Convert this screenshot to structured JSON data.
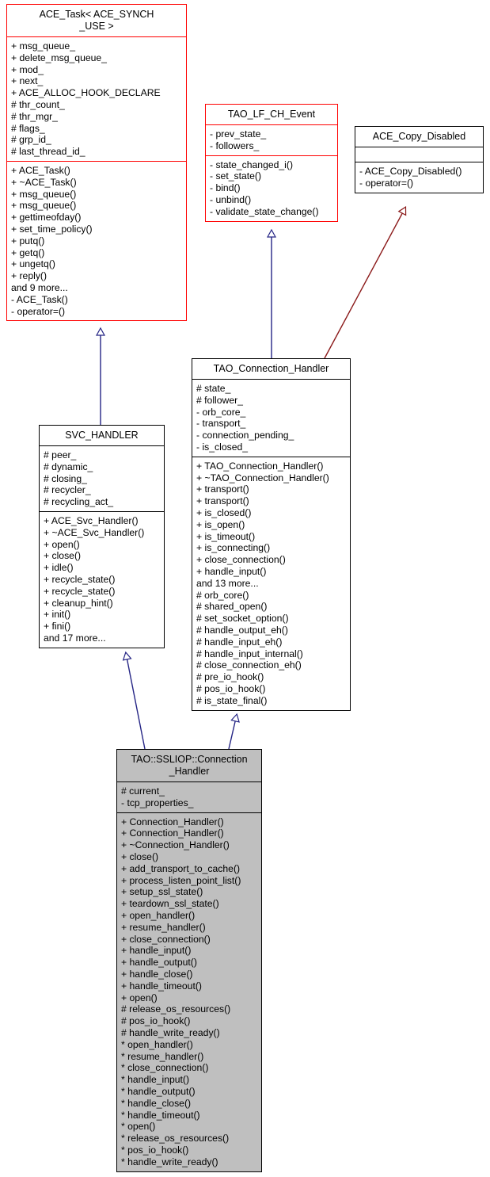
{
  "diagram": {
    "title": "TAO::SSLIOP::Connection_Handler inheritance diagram",
    "type": "uml-class-diagram",
    "background": "#ffffff",
    "colors": {
      "highlight_border": "#ff0000",
      "normal_border": "#000000",
      "derived_fill": "#bfbfbf",
      "inheritance_edge": "#252585",
      "usage_edge": "#8b1a1a"
    }
  },
  "classes": {
    "ace_task": {
      "name": "ACE_Task< ACE_SYNCH\n_USE >",
      "attributes": [
        "+ msg_queue_",
        "+ delete_msg_queue_",
        "+ mod_",
        "+ next_",
        "+ ACE_ALLOC_HOOK_DECLARE",
        "# thr_count_",
        "# thr_mgr_",
        "# flags_",
        "# grp_id_",
        "# last_thread_id_"
      ],
      "operations": [
        "+ ACE_Task()",
        "+ ~ACE_Task()",
        "+ msg_queue()",
        "+ msg_queue()",
        "+ gettimeofday()",
        "+ set_time_policy()",
        "+ putq()",
        "+ getq()",
        "+ ungetq()",
        "+ reply()",
        "and 9 more...",
        "- ACE_Task()",
        "- operator=()"
      ]
    },
    "tao_lf_ch_event": {
      "name": "TAO_LF_CH_Event",
      "attributes": [
        "- prev_state_",
        "- followers_"
      ],
      "operations": [
        "- state_changed_i()",
        "- set_state()",
        "- bind()",
        "- unbind()",
        "- validate_state_change()"
      ]
    },
    "ace_copy_disabled": {
      "name": "ACE_Copy_Disabled",
      "attributes": [],
      "operations": [
        "- ACE_Copy_Disabled()",
        "- operator=()"
      ]
    },
    "tao_connection_handler": {
      "name": "TAO_Connection_Handler",
      "attributes": [
        "# state_",
        "# follower_",
        "- orb_core_",
        "- transport_",
        "- connection_pending_",
        "- is_closed_"
      ],
      "operations": [
        "+ TAO_Connection_Handler()",
        "+ ~TAO_Connection_Handler()",
        "+ transport()",
        "+ transport()",
        "+ is_closed()",
        "+ is_open()",
        "+ is_timeout()",
        "+ is_connecting()",
        "+ close_connection()",
        "+ handle_input()",
        "and 13 more...",
        "# orb_core()",
        "# shared_open()",
        "# set_socket_option()",
        "# handle_output_eh()",
        "# handle_input_eh()",
        "# handle_input_internal()",
        "# close_connection_eh()",
        "# pre_io_hook()",
        "# pos_io_hook()",
        "# is_state_final()"
      ]
    },
    "svc_handler": {
      "name": "SVC_HANDLER",
      "attributes": [
        "# peer_",
        "# dynamic_",
        "# closing_",
        "# recycler_",
        "# recycling_act_"
      ],
      "operations": [
        "+ ACE_Svc_Handler()",
        "+ ~ACE_Svc_Handler()",
        "+ open()",
        "+ close()",
        "+ idle()",
        "+ recycle_state()",
        "+ recycle_state()",
        "+ cleanup_hint()",
        "+ init()",
        "+ fini()",
        "and 17 more..."
      ]
    },
    "ssliop_connection_handler": {
      "name": "TAO::SSLIOP::Connection\n_Handler",
      "attributes": [
        "# current_",
        "- tcp_properties_"
      ],
      "operations": [
        "+ Connection_Handler()",
        "+ Connection_Handler()",
        "+ ~Connection_Handler()",
        "+ close()",
        "+ add_transport_to_cache()",
        "+ process_listen_point_list()",
        "+ setup_ssl_state()",
        "+ teardown_ssl_state()",
        "+ open_handler()",
        "+ resume_handler()",
        "+ close_connection()",
        "+ handle_input()",
        "+ handle_output()",
        "+ handle_close()",
        "+ handle_timeout()",
        "+ open()",
        "# release_os_resources()",
        "# pos_io_hook()",
        "# handle_write_ready()",
        "* open_handler()",
        "* resume_handler()",
        "* close_connection()",
        "* handle_input()",
        "* handle_output()",
        "* handle_close()",
        "* handle_timeout()",
        "* open()",
        "* release_os_resources()",
        "* pos_io_hook()",
        "* handle_write_ready()"
      ]
    }
  },
  "edges": [
    {
      "from": "svc_handler",
      "to": "ace_task",
      "kind": "inheritance"
    },
    {
      "from": "tao_connection_handler",
      "to": "tao_lf_ch_event",
      "kind": "inheritance"
    },
    {
      "from": "tao_connection_handler",
      "to": "ace_copy_disabled",
      "kind": "usage"
    },
    {
      "from": "ssliop_connection_handler",
      "to": "svc_handler",
      "kind": "inheritance"
    },
    {
      "from": "ssliop_connection_handler",
      "to": "tao_connection_handler",
      "kind": "inheritance"
    }
  ]
}
